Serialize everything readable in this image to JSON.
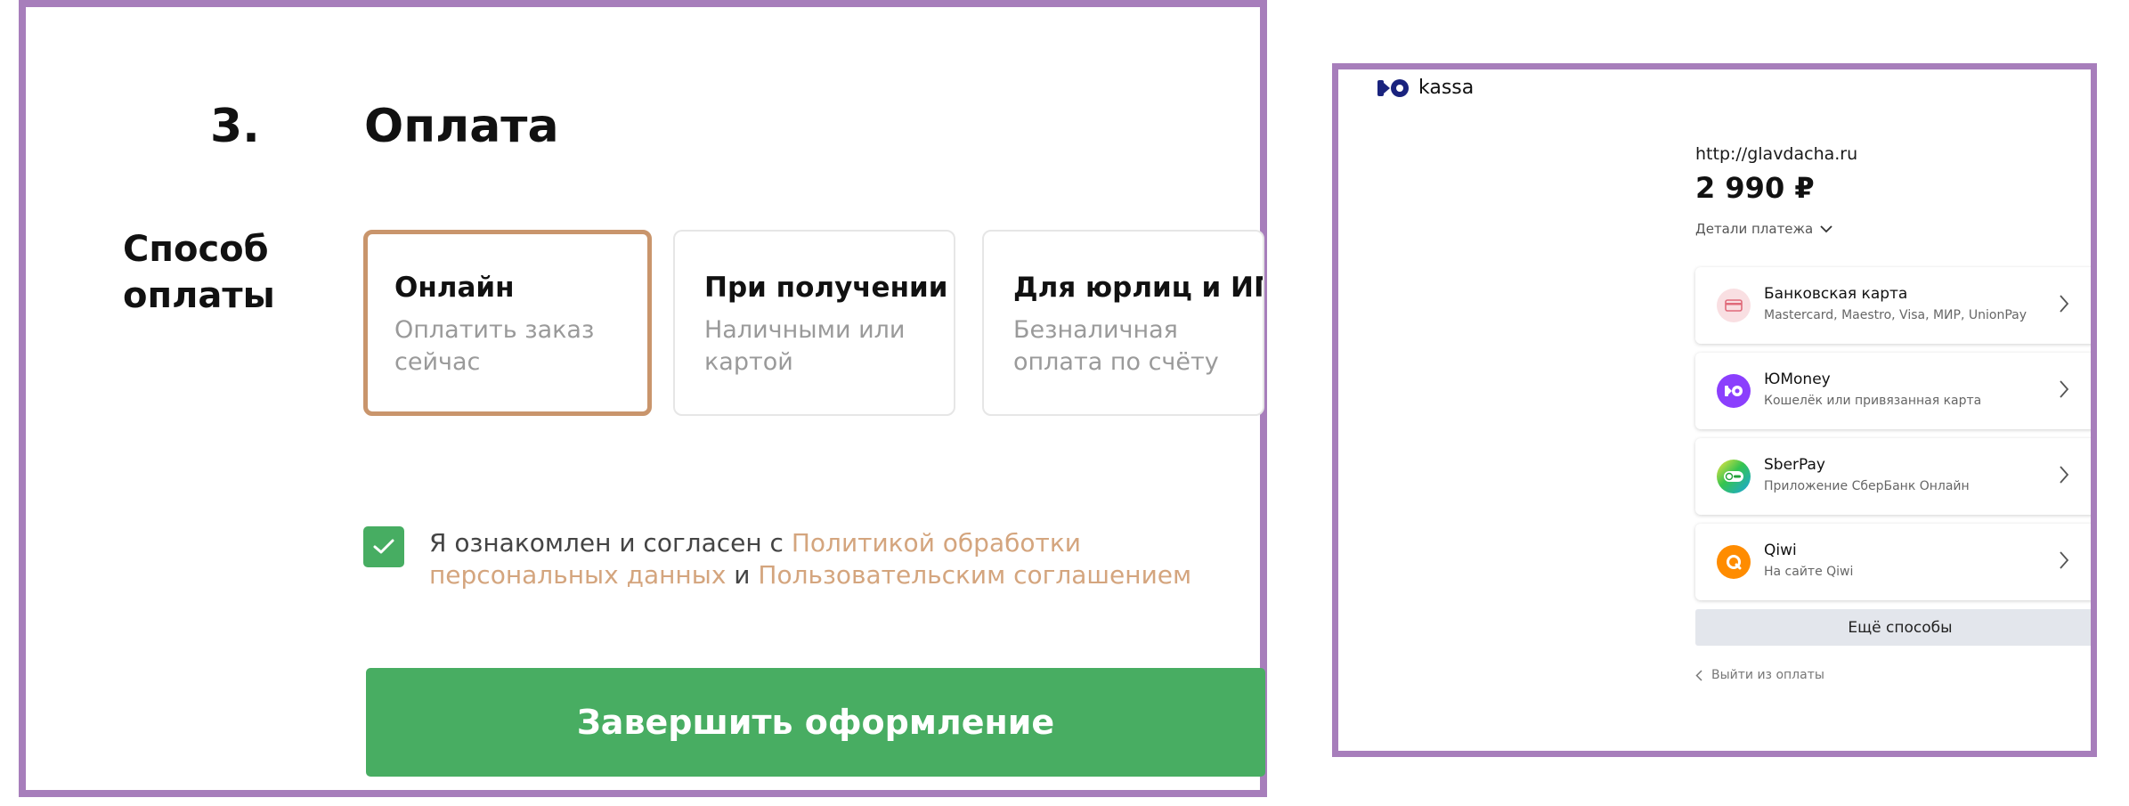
{
  "checkout": {
    "step_number": "3.",
    "step_title": "Оплата",
    "method_label": "Способ оплаты",
    "options": [
      {
        "title": "Онлайн",
        "desc": "Оплатить заказ сейчас",
        "selected": true
      },
      {
        "title": "При получении",
        "desc": "Наличными или картой",
        "selected": false
      },
      {
        "title": "Для юрлиц и ИП",
        "desc": "Безналичная оплата по счёту",
        "selected": false
      }
    ],
    "agreement": {
      "prefix": "Я ознакомлен и согласен с ",
      "policy_link": "Политикой обработки персональных данных",
      "conjunction": " и ",
      "terms_link": "Пользовательским соглашением",
      "checked": true
    },
    "submit_label": "Завершить оформление"
  },
  "kassa": {
    "brand": "kassa",
    "site_url": "http://glavdacha.ru",
    "amount": "2 990 ₽",
    "details_label": "Детали платежа",
    "methods": [
      {
        "name": "Банковская карта",
        "sub": "Mastercard, Maestro, Visa, МИР, UnionPay",
        "icon": "bank-card-icon"
      },
      {
        "name": "ЮMoney",
        "sub": "Кошелёк или привязанная карта",
        "icon": "yoomoney-icon"
      },
      {
        "name": "SberPay",
        "sub": "Приложение СберБанк Онлайн",
        "icon": "sberpay-icon"
      },
      {
        "name": "Qiwi",
        "sub": "На сайте Qiwi",
        "icon": "qiwi-icon"
      }
    ],
    "more_label": "Ещё способы",
    "exit_label": "Выйти из оплаты"
  },
  "colors": {
    "frame": "#a77ebb",
    "accent_green": "#47ad62",
    "link_orange": "#d4a57e",
    "selected_border": "#c9956c",
    "yoomoney_purple": "#8b3ffd",
    "qiwi_orange": "#ff8c00"
  }
}
